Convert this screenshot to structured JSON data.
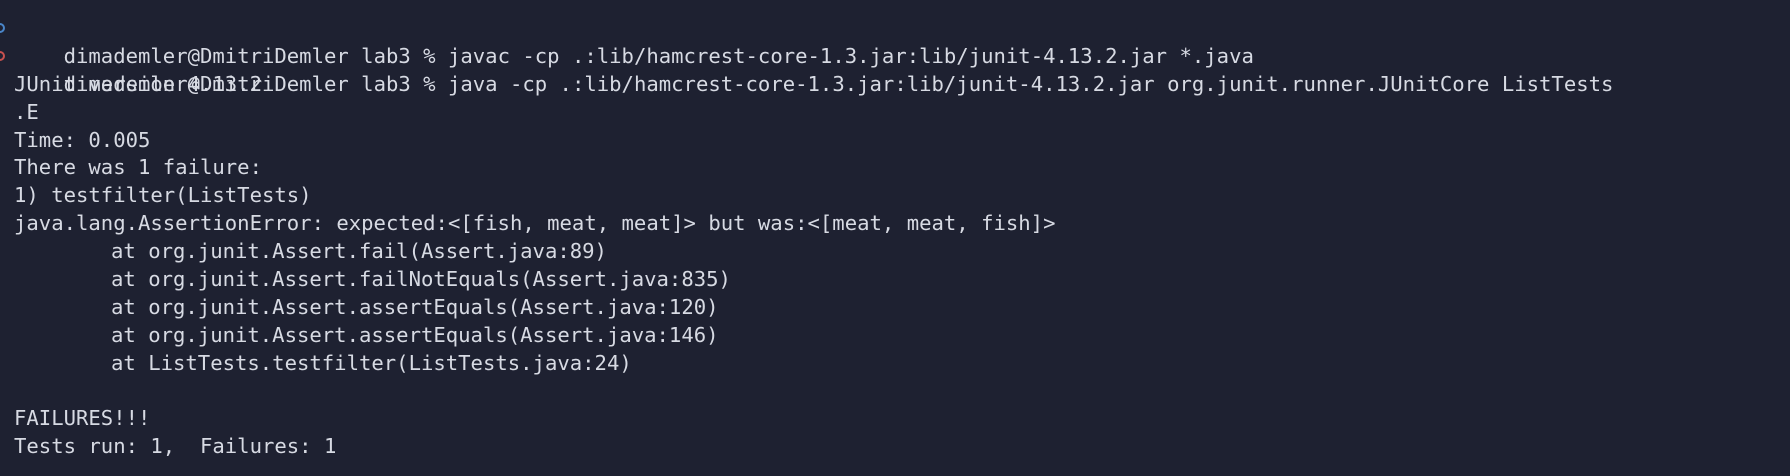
{
  "terminal": {
    "background": "#1e2131",
    "foreground": "#d7dae3",
    "marker_success_color": "#4a86c9",
    "marker_failure_color": "#c8514f",
    "commands": [
      {
        "prompt": "dimademler@DmitriDemler lab3 % ",
        "command": "javac -cp .:lib/hamcrest-core-1.3.jar:lib/junit-4.13.2.jar *.java"
      },
      {
        "prompt": "dimademler@DmitriDemler lab3 % ",
        "command": "java -cp .:lib/hamcrest-core-1.3.jar:lib/junit-4.13.2.jar org.junit.runner.JUnitCore ListTests"
      }
    ],
    "output": [
      "JUnit version 4.13.2",
      ".E",
      "Time: 0.005",
      "There was 1 failure:",
      "1) testfilter(ListTests)",
      "java.lang.AssertionError: expected:<[fish, meat, meat]> but was:<[meat, meat, fish]>"
    ],
    "stack_trace": [
      "at org.junit.Assert.fail(Assert.java:89)",
      "at org.junit.Assert.failNotEquals(Assert.java:835)",
      "at org.junit.Assert.assertEquals(Assert.java:120)",
      "at org.junit.Assert.assertEquals(Assert.java:146)",
      "at ListTests.testfilter(ListTests.java:24)"
    ],
    "summary": [
      "",
      "FAILURES!!!",
      "Tests run: 1,  Failures: 1"
    ]
  }
}
